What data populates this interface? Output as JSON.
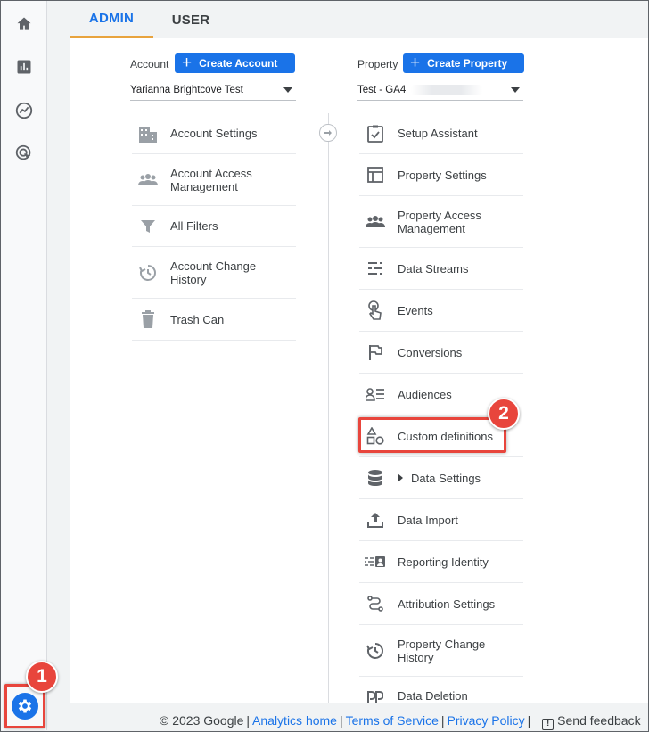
{
  "tabs": {
    "admin": "ADMIN",
    "user": "USER"
  },
  "account": {
    "label": "Account",
    "create_label": "Create Account",
    "selected": "Yarianna Brightcove Test",
    "items": [
      {
        "label": "Account Settings"
      },
      {
        "label": "Account Access Management"
      },
      {
        "label": "All Filters"
      },
      {
        "label": "Account Change History"
      },
      {
        "label": "Trash Can"
      }
    ]
  },
  "property": {
    "label": "Property",
    "create_label": "Create Property",
    "selected": "Test - GA4",
    "items": [
      {
        "label": "Setup Assistant"
      },
      {
        "label": "Property Settings"
      },
      {
        "label": "Property Access Management"
      },
      {
        "label": "Data Streams"
      },
      {
        "label": "Events"
      },
      {
        "label": "Conversions"
      },
      {
        "label": "Audiences"
      },
      {
        "label": "Custom definitions"
      },
      {
        "label": "Data Settings"
      },
      {
        "label": "Data Import"
      },
      {
        "label": "Reporting Identity"
      },
      {
        "label": "Attribution Settings"
      },
      {
        "label": "Property Change History"
      },
      {
        "label": "Data Deletion"
      }
    ]
  },
  "badges": {
    "one": "1",
    "two": "2"
  },
  "footer": {
    "copyright": "© 2023 Google",
    "analytics_home": "Analytics home",
    "terms": "Terms of Service",
    "privacy": "Privacy Policy",
    "feedback": "Send feedback"
  },
  "colors": {
    "accent": "#1a73e8",
    "annotation": "#e8453c",
    "tab_underline": "#e8a33d"
  }
}
